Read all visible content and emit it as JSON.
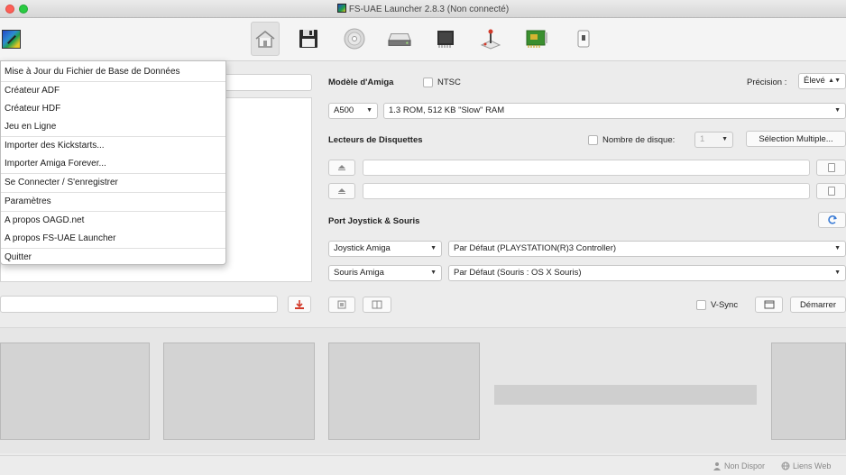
{
  "window": {
    "title": "FS-UAE Launcher 2.8.3 (Non connecté)"
  },
  "toolbar": {
    "icons": [
      "home-icon",
      "floppy-icon",
      "cd-icon",
      "hard-drive-icon",
      "memory-chip-icon",
      "joystick-icon",
      "expansion-card-icon",
      "small-device-icon"
    ]
  },
  "menu": {
    "items": [
      "Mise à Jour du Fichier de Base de Données",
      "Créateur ADF",
      "Créateur HDF",
      "Jeu en Ligne",
      "Importer des Kickstarts...",
      "Importer Amiga Forever...",
      "Se Connecter / S'enregistrer",
      "Paramètres",
      "A propos OAGD.net",
      "A propos FS-UAE Launcher",
      "Quitter"
    ]
  },
  "config": {
    "model_label": "Modèle d'Amiga",
    "ntsc_label": "NTSC",
    "precision_label": "Précision :",
    "precision_value": "Élevé",
    "model_value": "A500",
    "rom_value": "1.3 ROM, 512 KB \"Slow\" RAM",
    "floppy_label": "Lecteurs de Disquettes",
    "disk_count_label": "Nombre de disque:",
    "disk_count_value": "1",
    "multi_select_label": "Sélection Multiple...",
    "joystick_label": "Port Joystick & Souris",
    "port1_type": "Joystick Amiga",
    "port1_device": "Par Défaut (PLAYSTATION(R)3 Controller)",
    "port2_type": "Souris Amiga",
    "port2_device": "Par Défaut (Souris : OS X Souris)",
    "vsync_label": "V-Sync",
    "start_label": "Démarrer"
  },
  "status": {
    "offline": "Non Dispor",
    "weblinks": "Liens Web"
  },
  "colors": {
    "accent_red": "#d23a2a",
    "refresh_blue": "#3a7bd5"
  }
}
